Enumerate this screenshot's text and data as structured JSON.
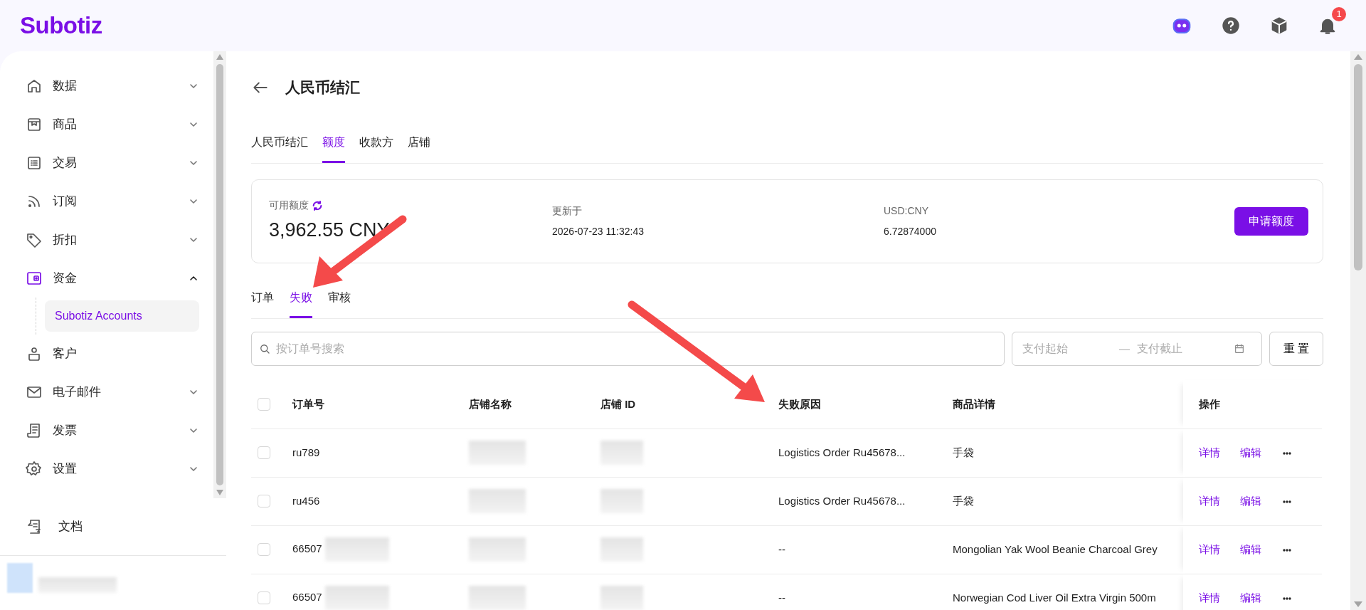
{
  "header": {
    "logo": "Subotiz",
    "notification_count": "1"
  },
  "sidebar": {
    "items": [
      {
        "label": "数据",
        "kind": "group",
        "expanded": false,
        "selected": false
      },
      {
        "label": "商品",
        "kind": "group",
        "expanded": false,
        "selected": false
      },
      {
        "label": "交易",
        "kind": "group",
        "expanded": false,
        "selected": false
      },
      {
        "label": "订阅",
        "kind": "group",
        "expanded": false,
        "selected": false
      },
      {
        "label": "折扣",
        "kind": "group",
        "expanded": false,
        "selected": false
      },
      {
        "label": "资金",
        "kind": "group",
        "expanded": true,
        "selected": true,
        "children": [
          {
            "label": "Subotiz Accounts",
            "selected": true
          }
        ]
      },
      {
        "label": "客户",
        "kind": "link",
        "selected": false
      },
      {
        "label": "电子邮件",
        "kind": "group",
        "expanded": false,
        "selected": false
      },
      {
        "label": "发票",
        "kind": "group",
        "expanded": false,
        "selected": false
      },
      {
        "label": "设置",
        "kind": "group",
        "expanded": false,
        "selected": false
      }
    ],
    "footer_items": [
      {
        "label": "文档"
      }
    ]
  },
  "page": {
    "title": "人民币结汇",
    "tabs": [
      {
        "label": "人民币结汇",
        "selected": false
      },
      {
        "label": "额度",
        "selected": true
      },
      {
        "label": "收款方",
        "selected": false
      },
      {
        "label": "店铺",
        "selected": false
      }
    ],
    "quota_card": {
      "label": "可用额度",
      "amount": "3,962.55 CNY",
      "updated_label": "更新于",
      "updated_value": "2026-07-23 11:32:43",
      "rate_label": "USD:CNY",
      "rate_value": "6.72874000",
      "button": "申请额度"
    },
    "sub_tabs": [
      {
        "label": "订单",
        "selected": false
      },
      {
        "label": "失败",
        "selected": true
      },
      {
        "label": "审核",
        "selected": false
      }
    ],
    "filters": {
      "search_placeholder": "按订单号搜索",
      "date_start_placeholder": "支付起始",
      "date_separator": "—",
      "date_end_placeholder": "支付截止",
      "reset_button": "重 置"
    },
    "table": {
      "select_all_checked": false,
      "columns": [
        "订单号",
        "店铺名称",
        "店铺 ID",
        "失败原因",
        "商品详情",
        "操作"
      ],
      "rows": [
        {
          "checked": false,
          "order_no": "ru789",
          "failure_reason": "Logistics Order Ru45678...",
          "product": "手袋",
          "actions": [
            "详情",
            "编辑"
          ]
        },
        {
          "checked": false,
          "order_no": "ru456",
          "failure_reason": "Logistics Order Ru45678...",
          "product": "手袋",
          "actions": [
            "详情",
            "编辑"
          ]
        },
        {
          "checked": false,
          "order_no": "66507",
          "failure_reason": "--",
          "product": "Mongolian Yak Wool Beanie Charcoal Grey",
          "actions": [
            "详情",
            "编辑"
          ]
        },
        {
          "checked": false,
          "order_no": "66507",
          "failure_reason": "--",
          "product": "Norwegian Cod Liver Oil Extra Virgin 500m",
          "actions": [
            "详情",
            "编辑"
          ]
        }
      ]
    }
  }
}
